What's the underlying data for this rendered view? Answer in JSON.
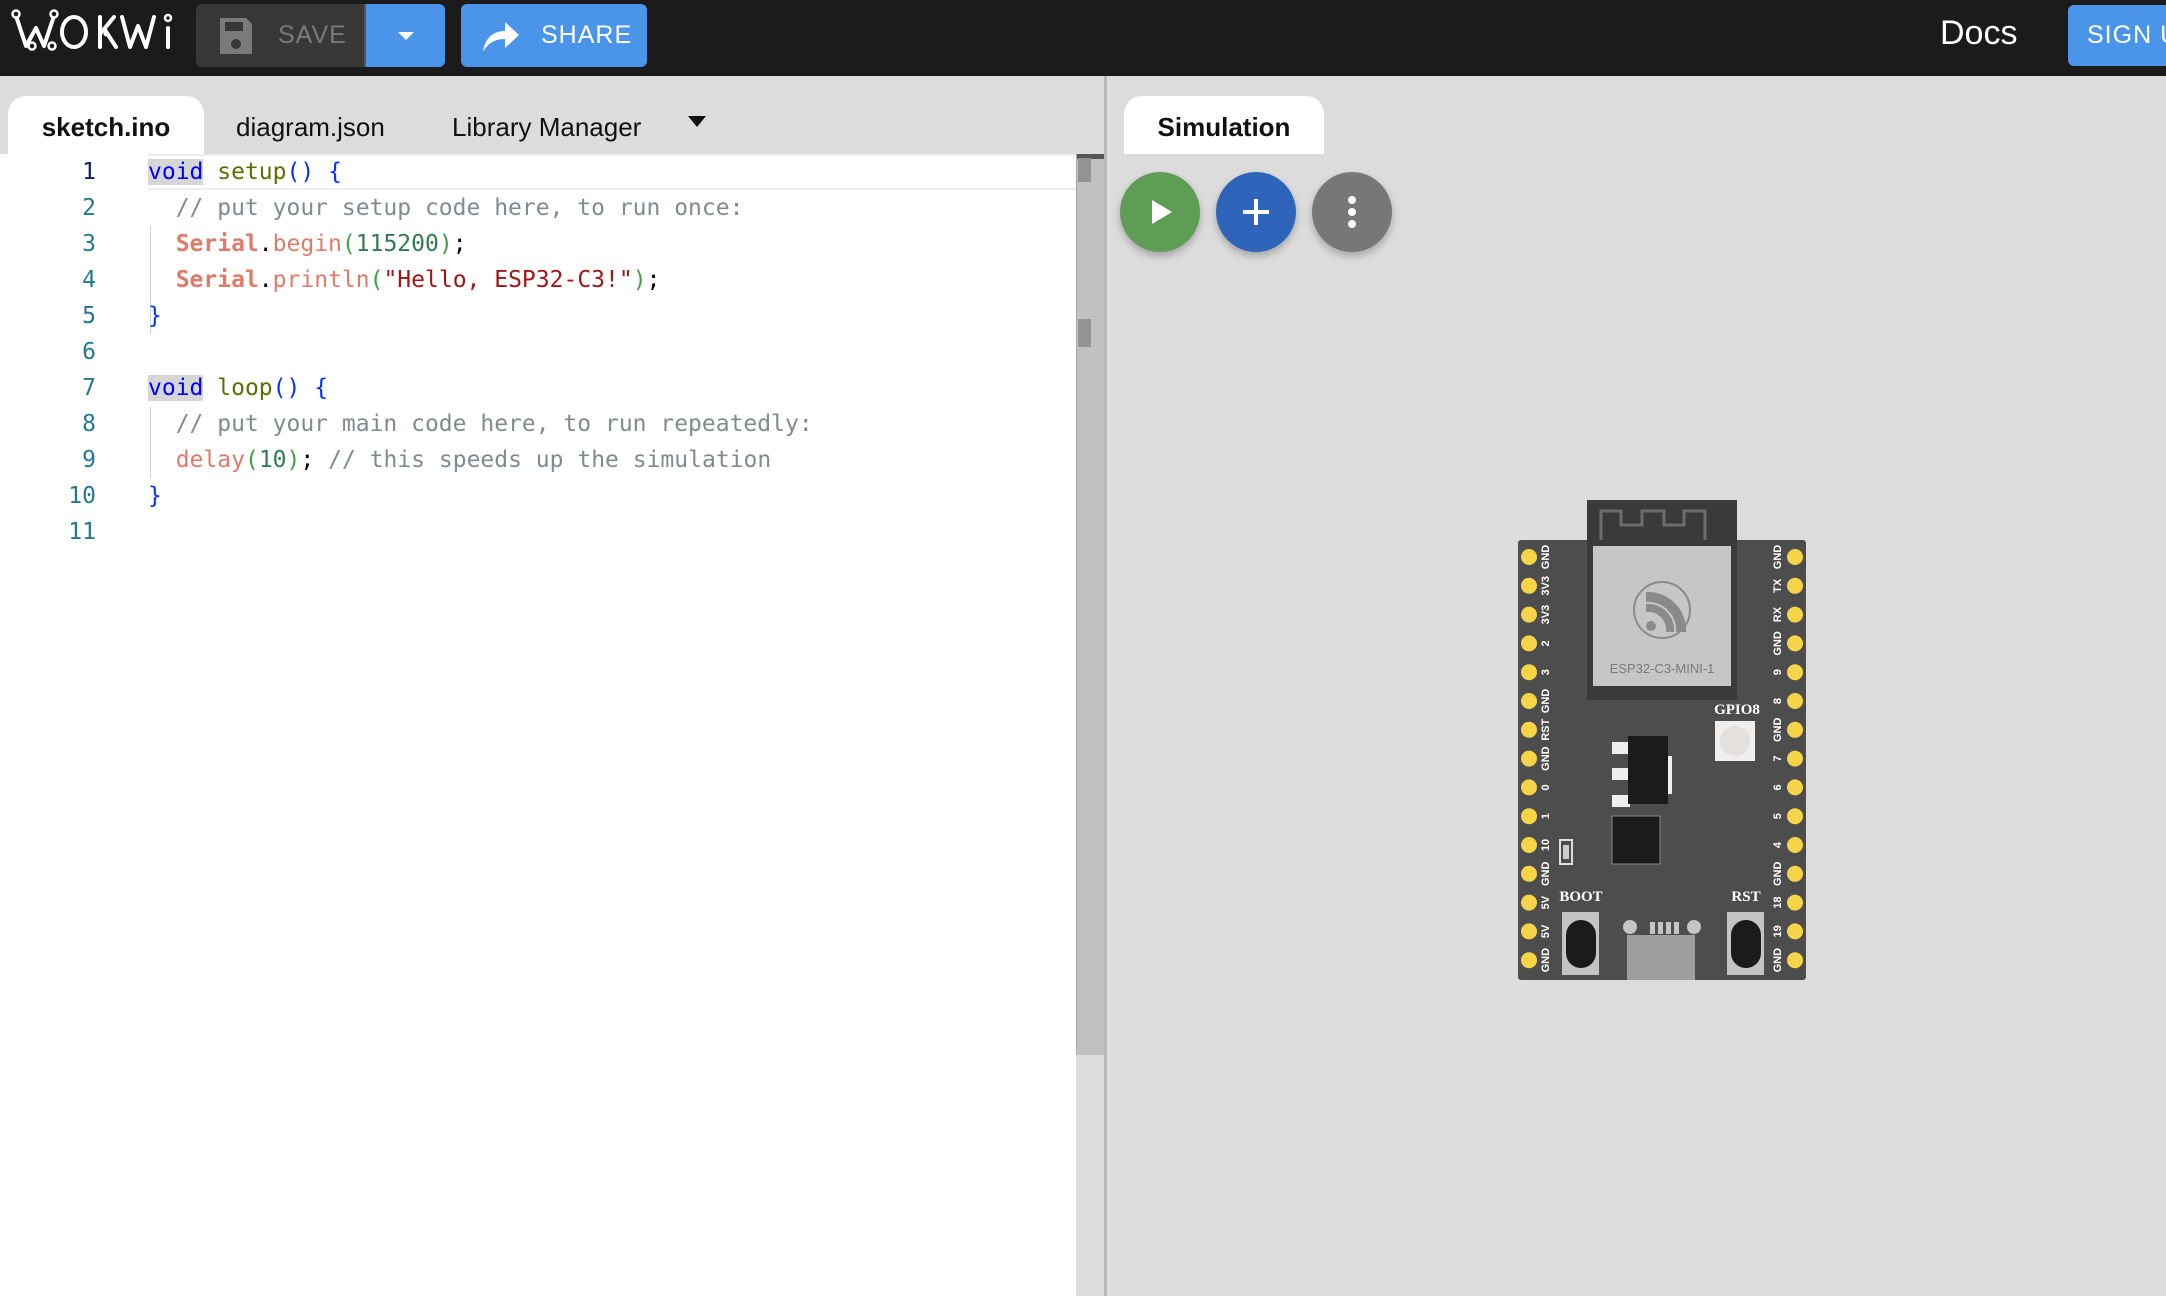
{
  "header": {
    "logo_text": "WOKWi",
    "save_label": "SAVE",
    "share_label": "SHARE",
    "docs_label": "Docs",
    "signup_label": "SIGN U",
    "icons": {
      "save": "floppy-disk-icon",
      "dropdown": "caret-down-icon",
      "share": "share-arrow-icon"
    },
    "colors": {
      "background": "#1b1b1b",
      "accent": "#4a94ea",
      "save_bg": "#383838"
    }
  },
  "editor": {
    "tabs": [
      {
        "label": "sketch.ino",
        "active": true
      },
      {
        "label": "diagram.json",
        "active": false
      },
      {
        "label": "Library Manager",
        "active": false
      }
    ],
    "lines": [
      {
        "number": "1",
        "text": "void setup() {"
      },
      {
        "number": "2",
        "text": "  // put your setup code here, to run once:"
      },
      {
        "number": "3",
        "text": "  Serial.begin(115200);"
      },
      {
        "number": "4",
        "text": "  Serial.println(\"Hello, ESP32-C3!\");"
      },
      {
        "number": "5",
        "text": "}"
      },
      {
        "number": "6",
        "text": ""
      },
      {
        "number": "7",
        "text": "void loop() {"
      },
      {
        "number": "8",
        "text": "  // put your main code here, to run repeatedly:"
      },
      {
        "number": "9",
        "text": "  delay(10); // this speeds up the simulation"
      },
      {
        "number": "10",
        "text": "}"
      },
      {
        "number": "11",
        "text": ""
      }
    ],
    "tokens": {
      "void": "void",
      "setup": "setup",
      "loop": "loop",
      "paren_open_close": "()",
      "brace_open": "{",
      "brace_close": "}",
      "comment_setup": "// put your setup code here, to run once:",
      "comment_loop": "// put your main code here, to run repeatedly:",
      "comment_delay": "// this speeds up the simulation",
      "serial": "Serial",
      "dot": ".",
      "begin": "begin",
      "println": "println",
      "delay": "delay",
      "lparen": "(",
      "rparen": ")",
      "semi": ";",
      "baud": "115200",
      "hello": "\"Hello, ESP32-C3!\"",
      "delay_ms": "10"
    }
  },
  "simulation": {
    "tab_label": "Simulation",
    "buttons": [
      {
        "name": "start-simulation",
        "icon": "play-icon",
        "color": "#5e9e54"
      },
      {
        "name": "add-part",
        "icon": "plus-icon",
        "color": "#2f64bb"
      },
      {
        "name": "more-options",
        "icon": "more-vertical-icon",
        "color": "#777777"
      }
    ],
    "board": {
      "module_label": "ESP32-C3-MINI-1",
      "led_label": "GPIO8",
      "boot_label": "BOOT",
      "rst_label": "RST",
      "left_pins": [
        "GND",
        "3V3",
        "3V3",
        "2",
        "3",
        "GND",
        "RST",
        "GND",
        "0",
        "1",
        "10",
        "GND",
        "5V",
        "5V",
        "GND"
      ],
      "right_pins": [
        "GND",
        "TX",
        "RX",
        "GND",
        "9",
        "8",
        "GND",
        "7",
        "6",
        "5",
        "4",
        "GND",
        "18",
        "19",
        "GND"
      ],
      "colors": {
        "pcb": "#4d4d4d",
        "pin": "#f5d547",
        "module": "#c6c6c6"
      }
    }
  }
}
